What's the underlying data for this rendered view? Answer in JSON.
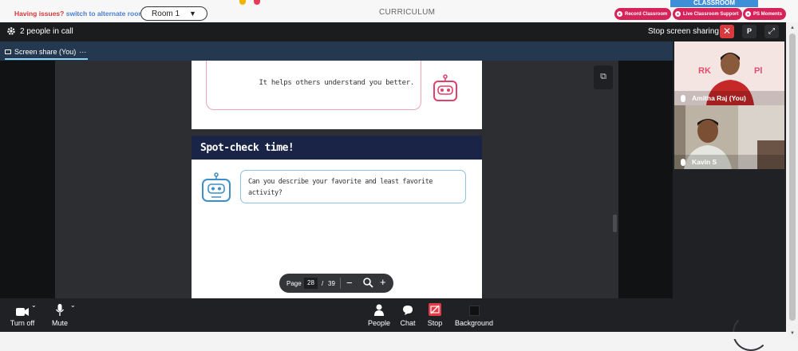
{
  "topbar": {
    "issues_label": "Having issues?",
    "switch_label": "switch to alternate room",
    "room_label": "Room 1",
    "curriculum_label": "CURRICULUM",
    "classroom_label": "CLASSROOM",
    "record_label": "Record Classroom",
    "support_label": "Live Classroom Support",
    "moments_label": "PS Moments"
  },
  "call": {
    "people_count": "2 people in call",
    "stop_sharing_label": "Stop screen sharing",
    "close_icon": "✕",
    "p_label": "P",
    "expand_icon": "⤢",
    "tab_label": "Screen share (You)",
    "tab_more": "···"
  },
  "slide": {
    "bubble1_text": "It helps others understand you better.",
    "heading": "Spot-check time!",
    "bubble2_text": "Can you describe your favorite and least favorite activity?"
  },
  "pager": {
    "page_label": "Page",
    "current_page": "28",
    "slash": "/",
    "total_pages": "39",
    "minus": "−",
    "plus": "+"
  },
  "participants": [
    {
      "name": "Amitha Raj (You)"
    },
    {
      "name": "Kavin S"
    }
  ],
  "controls": {
    "camera_label": "Turn off",
    "mic_label": "Mute",
    "people_label": "People",
    "chat_label": "Chat",
    "stop_label": "Stop",
    "background_label": "Background"
  },
  "colors": {
    "accent_red": "#d6245a",
    "tab_bar": "#24394f",
    "slide_header": "#1a2446"
  }
}
